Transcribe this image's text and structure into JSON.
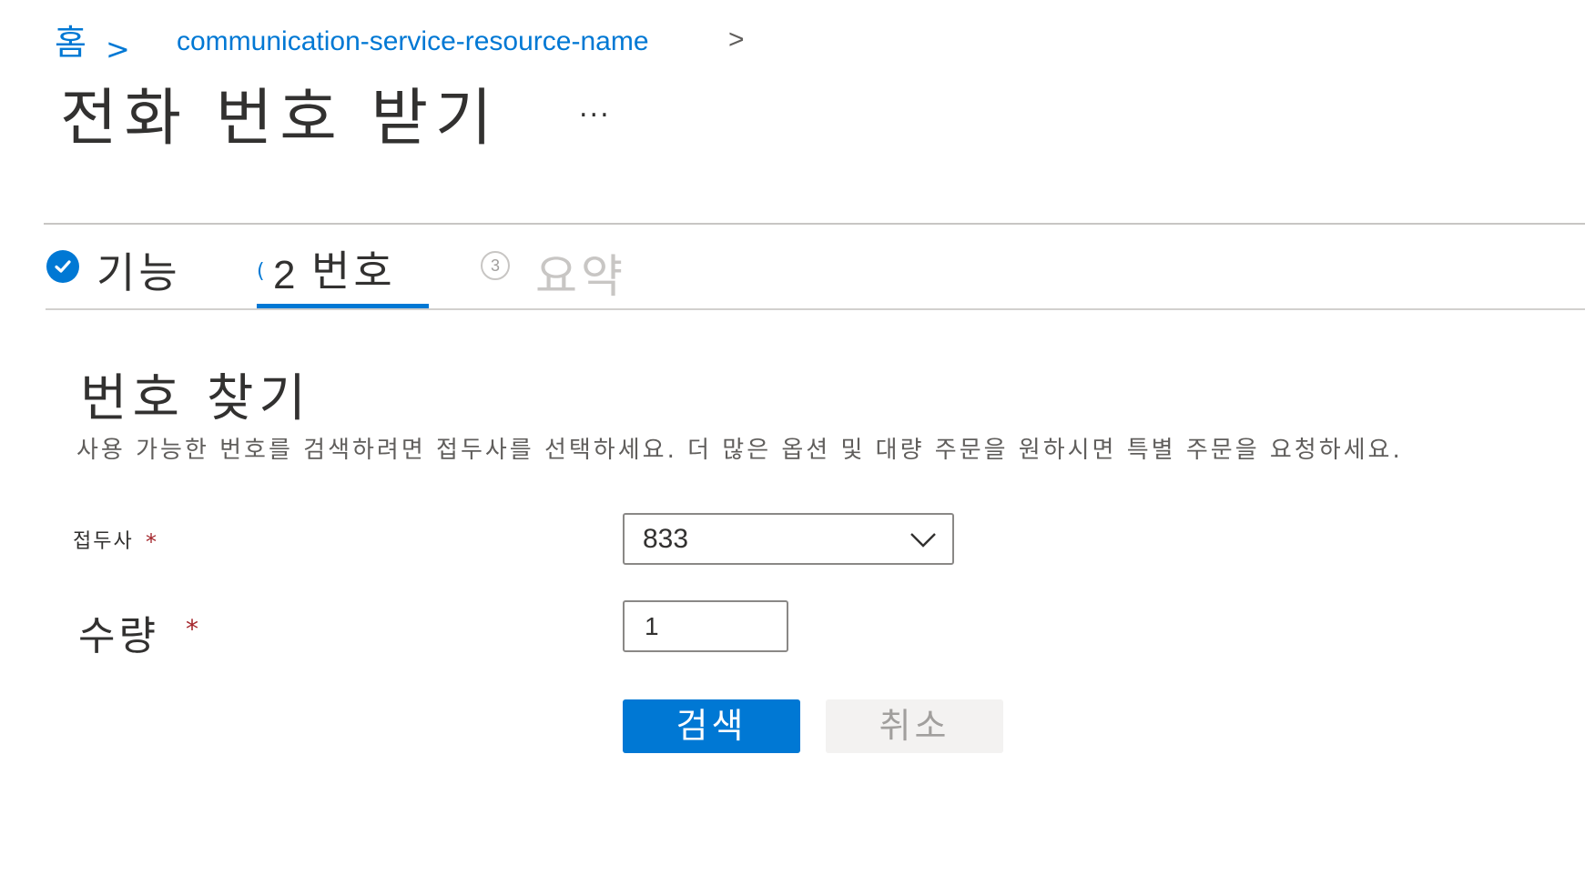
{
  "breadcrumb": {
    "home": "홈",
    "separator": ">",
    "resource": "communication-service-resource-name",
    "trailing_separator": ">"
  },
  "page": {
    "title": "전화 번호 받기",
    "more": "..."
  },
  "tabs": [
    {
      "label": "기능",
      "status": "completed",
      "icon": "check-circle-icon"
    },
    {
      "number": "2",
      "label": "번호",
      "status": "active"
    },
    {
      "number": "3",
      "label": "요약",
      "status": "disabled"
    }
  ],
  "section": {
    "title": "번호 찾기",
    "description": "사용 가능한 번호를 검색하려면 접두사를 선택하세요. 더 많은 옵션 및 대량 주문을 원하시면 특별 주문을 요청하세요."
  },
  "form": {
    "prefix_label": "접두사",
    "prefix_required": "*",
    "prefix_value": "833",
    "quantity_label": "수량",
    "quantity_required": "*",
    "quantity_value": "1"
  },
  "buttons": {
    "search": "검색",
    "cancel": "취소"
  },
  "colors": {
    "accent": "#0078d4",
    "required": "#a4262c",
    "disabled_text": "#a19f9d"
  }
}
